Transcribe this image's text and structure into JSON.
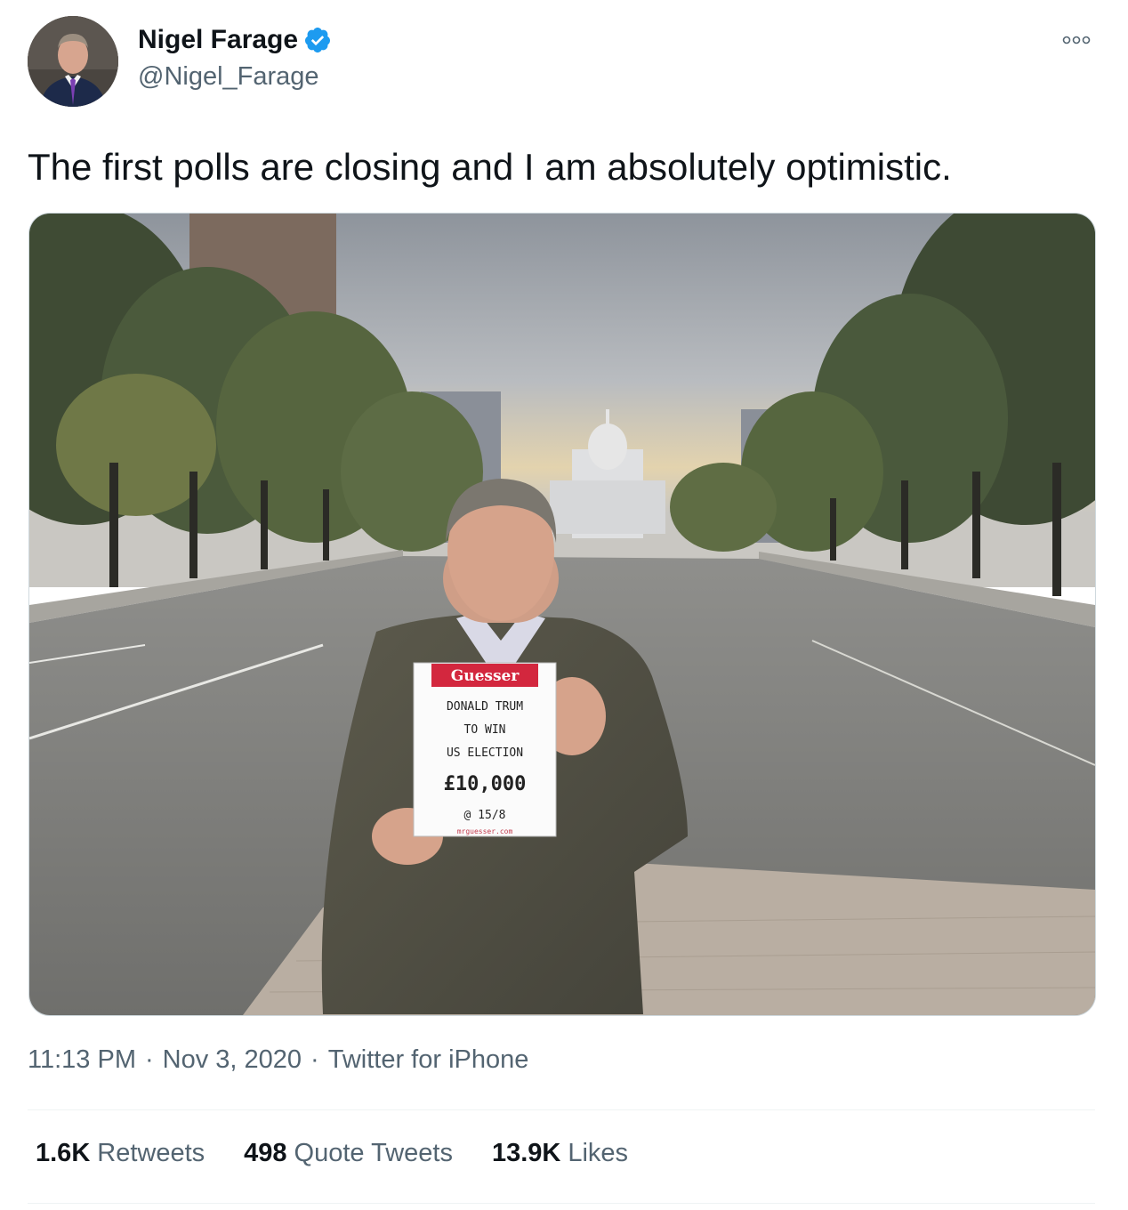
{
  "author": {
    "display_name": "Nigel Farage",
    "handle": "@Nigel_Farage",
    "verified": true,
    "avatar_icon": "profile-photo"
  },
  "more_icon": "ellipsis-icon",
  "tweet": {
    "text": "The first polls are closing and I am absolutely optimistic."
  },
  "media": {
    "sign": {
      "brand": "Guesser",
      "line1": "DONALD TRUM",
      "line2": "TO WIN",
      "line3": "US ELECTION",
      "amount": "£10,000",
      "odds": "@ 15/8",
      "footer": "mrguesser.com"
    }
  },
  "meta": {
    "time": "11:13 PM",
    "date": "Nov 3, 2020",
    "source": "Twitter for iPhone",
    "separator": "·"
  },
  "stats": {
    "retweets_count": "1.6K",
    "retweets_label": "Retweets",
    "quotes_count": "498",
    "quotes_label": "Quote Tweets",
    "likes_count": "13.9K",
    "likes_label": "Likes"
  },
  "colors": {
    "verified": "#1d9bf0",
    "text_primary": "#0f1419",
    "text_secondary": "#536471",
    "divider": "#eff3f4"
  }
}
